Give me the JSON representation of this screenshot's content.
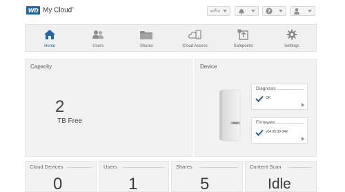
{
  "app": {
    "logo": "WD",
    "title": "My Cloud"
  },
  "header_buttons": [
    {
      "icon": "usb-icon"
    },
    {
      "icon": "bell-icon"
    },
    {
      "icon": "help-icon"
    },
    {
      "icon": "user-icon"
    }
  ],
  "nav": [
    {
      "label": "Home",
      "icon": "home-icon",
      "active": true
    },
    {
      "label": "Users",
      "icon": "users-icon"
    },
    {
      "label": "Shares",
      "icon": "folder-icon"
    },
    {
      "label": "Cloud Access",
      "icon": "cloud-access-icon"
    },
    {
      "label": "Safepoints",
      "icon": "safepoint-icon"
    },
    {
      "label": "Settings",
      "icon": "gear-icon"
    }
  ],
  "capacity": {
    "title": "Capacity",
    "value": "2",
    "unit": "TB Free"
  },
  "device": {
    "title": "Device",
    "diagnosis": {
      "title": "Diagnosis",
      "value": "OK"
    },
    "firmware": {
      "title": "Firmware",
      "value": "v04.05.00-342"
    }
  },
  "stats": [
    {
      "title": "Cloud Devices",
      "value": "0"
    },
    {
      "title": "Users",
      "value": "1"
    },
    {
      "title": "Shares",
      "value": "5"
    },
    {
      "title": "Content Scan",
      "value": "Idle"
    }
  ],
  "colors": {
    "accent": "#1f66b0",
    "check": "#1b5e9a",
    "panel": "#f2f2f2"
  }
}
